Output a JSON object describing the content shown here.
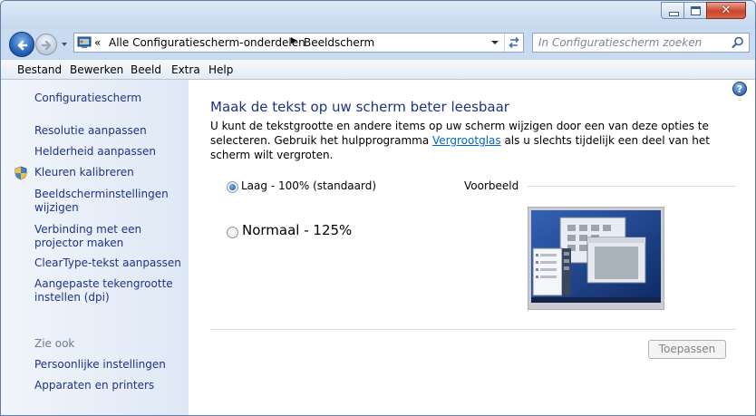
{
  "window": {
    "controls": {
      "minimize": "minimize",
      "maximize": "maximize",
      "close": "✕"
    }
  },
  "navbar": {
    "address_sep": "«",
    "crumbs": [
      "Alle Configuratiescherm-onderdelen",
      "Beeldscherm"
    ],
    "crumb_arrow": "▶",
    "search_placeholder": "In Configuratiescherm zoeken"
  },
  "menu": {
    "items": [
      "Bestand",
      "Bewerken",
      "Beeld",
      "Extra",
      "Help"
    ]
  },
  "sidebar": {
    "home": "Configuratiescherm",
    "links": [
      "Resolutie aanpassen",
      "Helderheid aanpassen",
      "Kleuren kalibreren",
      "Beeldscherminstellingen wijzigen",
      "Verbinding met een projector maken",
      "ClearType-tekst aanpassen",
      "Aangepaste tekengrootte instellen (dpi)"
    ],
    "see_also": "Zie ook",
    "see_also_links": [
      "Persoonlijke instellingen",
      "Apparaten en printers"
    ]
  },
  "main": {
    "help": "?",
    "title": "Maak de tekst op uw scherm beter leesbaar",
    "desc_before": "U kunt de tekstgrootte en andere items op uw scherm wijzigen door een van deze opties te selecteren. Gebruik het hulpprogramma ",
    "desc_link": "Vergrootglas",
    "desc_after": " als u slechts tijdelijk een deel van het scherm wilt vergroten.",
    "options": [
      {
        "label": "Laag - 100% (standaard)",
        "selected": true
      },
      {
        "label": "Normaal - 125%",
        "selected": false
      }
    ],
    "preview_label": "Voorbeeld",
    "apply_button": "Toepassen"
  },
  "colors": {
    "link": "#1e3287",
    "hyperlink": "#0066cc",
    "sidebar_bg": "#e4ecf6",
    "title": "#1e3287"
  }
}
